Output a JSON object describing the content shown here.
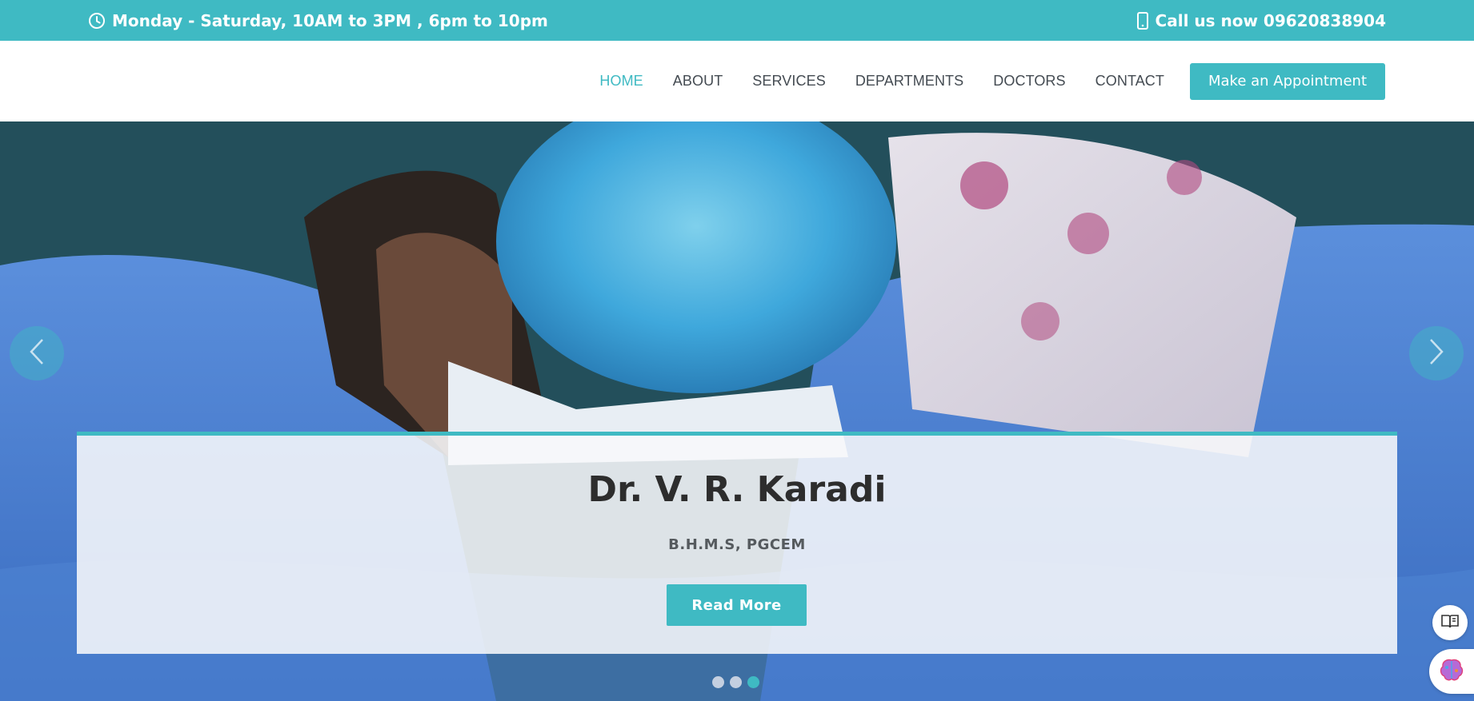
{
  "topbar": {
    "hours": "Monday - Saturday, 10AM to 3PM , 6pm to 10pm",
    "phone": "Call us now 09620838904",
    "clock_icon": "clock-icon",
    "phone_icon": "mobile-phone-icon"
  },
  "nav": {
    "links": [
      "HOME",
      "ABOUT",
      "SERVICES",
      "DEPARTMENTS",
      "DOCTORS",
      "CONTACT"
    ],
    "active": "HOME",
    "cta": "Make an Appointment"
  },
  "hero": {
    "title": "Dr. V. R. Karadi",
    "subtitle": "B.H.M.S, PGCEM",
    "button": "Read More",
    "slides": 3,
    "active_slide": 3
  },
  "floating": {
    "reader_icon": "immersive-reader-icon",
    "assistant_icon": "brain-assistant-icon"
  },
  "colors": {
    "accent": "#3fbac3",
    "nav_text": "#444b52",
    "title_text": "#2d2d2d"
  }
}
